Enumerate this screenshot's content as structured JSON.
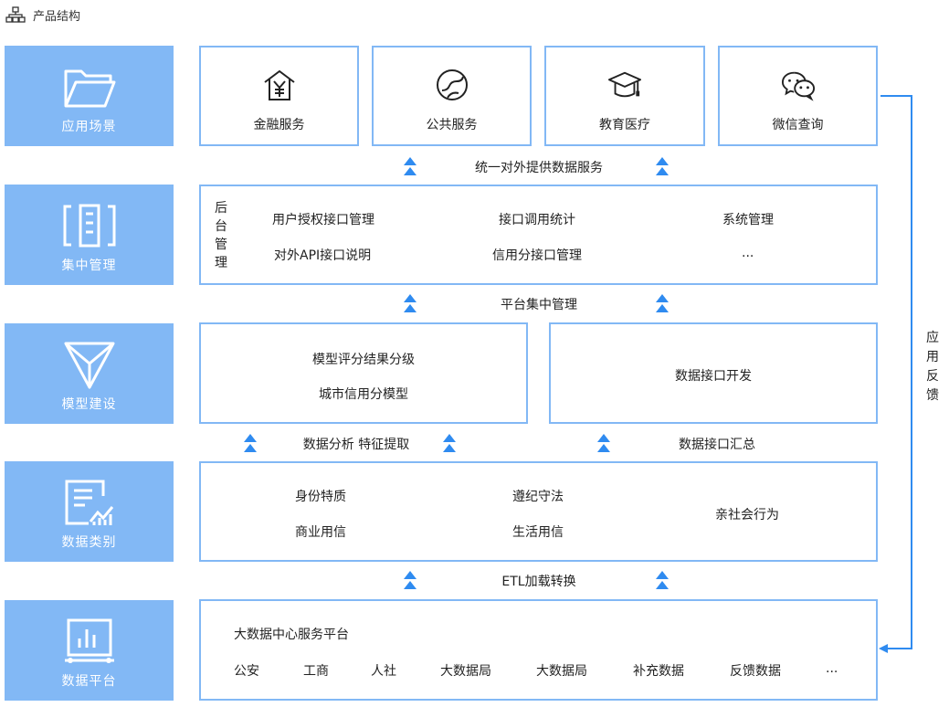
{
  "page_title": "产品结构",
  "layers": [
    {
      "label": "应用场景",
      "icon": "folder-icon"
    },
    {
      "label": "集中管理",
      "icon": "management-icon"
    },
    {
      "label": "模型建设",
      "icon": "model-icon"
    },
    {
      "label": "数据类别",
      "icon": "data-category-icon"
    },
    {
      "label": "数据平台",
      "icon": "data-platform-icon"
    }
  ],
  "scenarios": [
    {
      "label": "金融服务",
      "icon": "finance-house-icon"
    },
    {
      "label": "公共服务",
      "icon": "public-globe-icon"
    },
    {
      "label": "教育医疗",
      "icon": "graduation-cap-icon"
    },
    {
      "label": "微信查询",
      "icon": "wechat-icon"
    }
  ],
  "connectors": {
    "c1": "统一对外提供数据服务",
    "c2": "平台集中管理",
    "c3a": "数据分析 特征提取",
    "c3b": "数据接口汇总",
    "c4": "ETL加载转换"
  },
  "management": {
    "side_label": [
      "后",
      "台",
      "管",
      "理"
    ],
    "items": [
      "用户授权接口管理",
      "接口调用统计",
      "系统管理",
      "对外API接口说明",
      "信用分接口管理",
      "..."
    ]
  },
  "model": {
    "left_items": [
      "模型评分结果分级",
      "城市信用分模型"
    ],
    "right_item": "数据接口开发"
  },
  "data_category": {
    "items": [
      "身份特质",
      "遵纪守法",
      "商业用信",
      "生活用信",
      "亲社会行为"
    ]
  },
  "platform": {
    "title": "大数据中心服务平台",
    "items": [
      "公安",
      "工商",
      "人社",
      "大数据局",
      "大数据局",
      "补充数据",
      "反馈数据",
      "..."
    ]
  },
  "feedback": [
    "应",
    "用",
    "反",
    "馈"
  ],
  "colors": {
    "accent": "#82b8f5",
    "arrow": "#2f8bf0",
    "feedback_line": "#2f8bf0"
  }
}
